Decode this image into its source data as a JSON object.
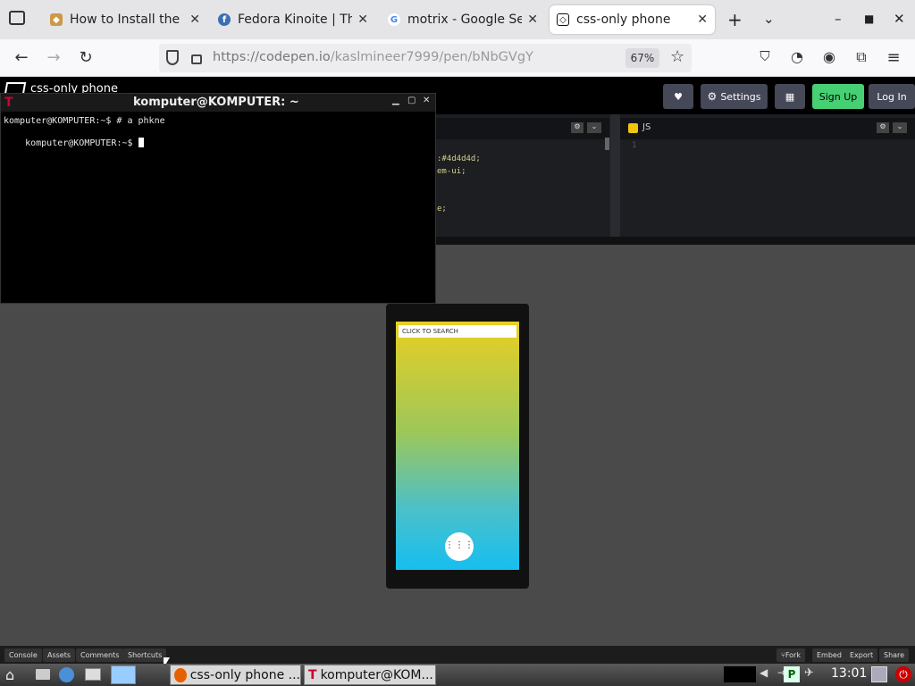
{
  "browser": {
    "tabs": [
      {
        "title": "How to Install the L",
        "icon": "unity-icon"
      },
      {
        "title": "Fedora Kinoite | The",
        "icon": "fedora-icon"
      },
      {
        "title": "motrix - Google Sea",
        "icon": "google-icon"
      },
      {
        "title": "css-only phone",
        "icon": "codepen-icon",
        "active": true
      }
    ],
    "new_tab_label": "+",
    "url": {
      "host": "https://codepen.io",
      "path": "/kaslmineer7999/pen/bNbGVgY"
    },
    "zoom": "67%"
  },
  "codepen": {
    "title": "css-only phone",
    "settings_label": "Settings",
    "signup_label": "Sign Up",
    "login_label": "Log In",
    "js_label": "JS",
    "code_lines": [
      ":#4d4d4d;",
      "em-ui;",
      "e;"
    ],
    "js_line": "1",
    "footer": {
      "left": [
        "Console",
        "Assets",
        "Comments",
        "Shortcuts"
      ],
      "right": [
        "Fork",
        "Embed",
        "Export",
        "Share"
      ]
    }
  },
  "terminal": {
    "title": "komputer@KOMPUTER: ~",
    "lines": [
      "komputer@KOMPUTER:~$ # a phkne",
      "komputer@KOMPUTER:~$ "
    ]
  },
  "phone": {
    "search_placeholder": "CLICK TO SEARCH",
    "app_button": "⋮⋮⋮"
  },
  "taskbar": {
    "tasks": [
      "css-only phone ...",
      "komputer@KOM..."
    ],
    "clock": "13:01"
  },
  "colors": {
    "signup": "#47cf73",
    "phone_top": "#e9cf22",
    "phone_bottom": "#16bff0"
  }
}
